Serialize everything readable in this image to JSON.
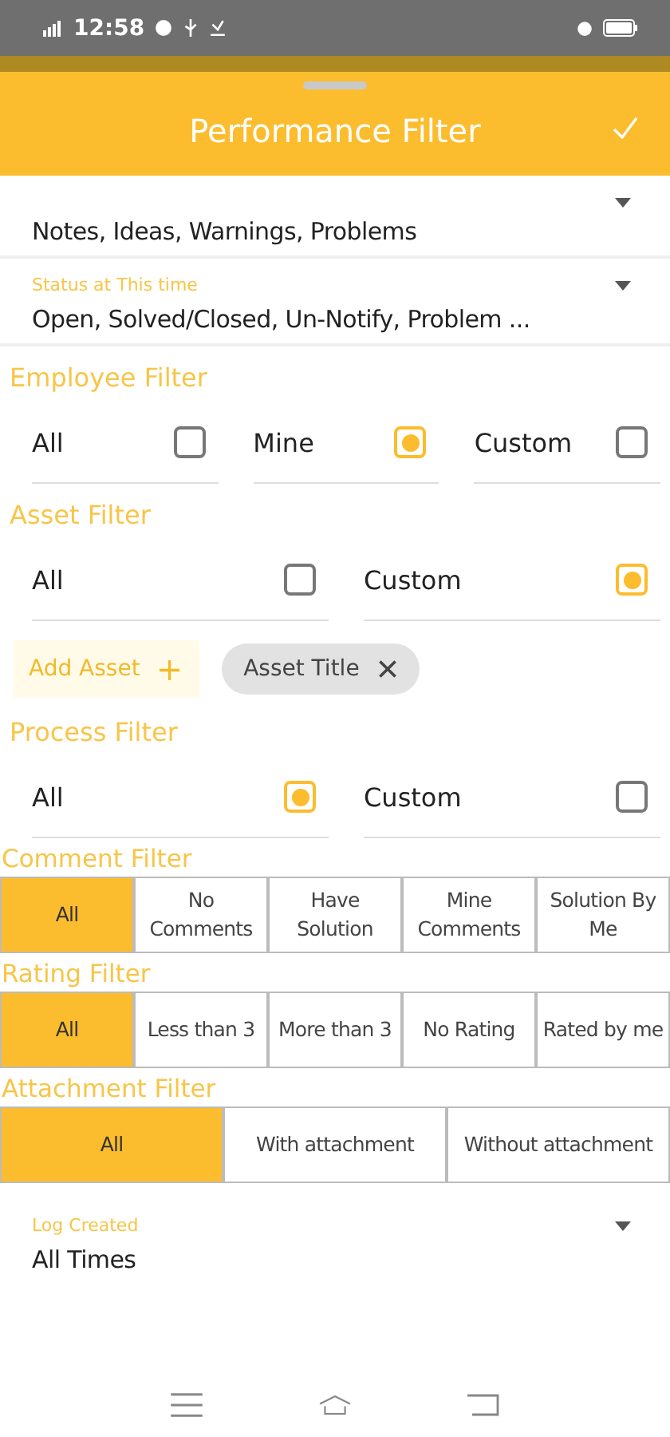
{
  "status_bar": {
    "time": "12:58"
  },
  "header": {
    "title": "Performance Filter"
  },
  "log_type": {
    "value": "Notes, Ideas, Warnings, Problems"
  },
  "status_field": {
    "label": "Status at This time",
    "value": "Open, Solved/Closed, Un-Notify, Problem ..."
  },
  "employee_filter": {
    "title": "Employee Filter",
    "options": [
      {
        "label": "All",
        "selected": false
      },
      {
        "label": "Mine",
        "selected": true
      },
      {
        "label": "Custom",
        "selected": false
      }
    ]
  },
  "asset_filter": {
    "title": "Asset Filter",
    "options": [
      {
        "label": "All",
        "selected": false
      },
      {
        "label": "Custom",
        "selected": true
      }
    ],
    "add_label": "Add Asset",
    "add_icon": "+",
    "chips": [
      {
        "label": "Asset Title"
      }
    ]
  },
  "process_filter": {
    "title": "Process Filter",
    "options": [
      {
        "label": "All",
        "selected": true
      },
      {
        "label": "Custom",
        "selected": false
      }
    ]
  },
  "comment_filter": {
    "title": "Comment Filter",
    "segments": [
      {
        "label": "All",
        "selected": true
      },
      {
        "label": "No Comments",
        "selected": false
      },
      {
        "label": "Have Solution",
        "selected": false
      },
      {
        "label": "Mine Comments",
        "selected": false
      },
      {
        "label": "Solution By Me",
        "selected": false
      }
    ]
  },
  "rating_filter": {
    "title": "Rating Filter",
    "segments": [
      {
        "label": "All",
        "selected": true
      },
      {
        "label": "Less than 3",
        "selected": false
      },
      {
        "label": "More than 3",
        "selected": false
      },
      {
        "label": "No Rating",
        "selected": false
      },
      {
        "label": "Rated by me",
        "selected": false
      }
    ]
  },
  "attachment_filter": {
    "title": "Attachment Filter",
    "segments": [
      {
        "label": "All",
        "selected": true
      },
      {
        "label": "With attachment",
        "selected": false
      },
      {
        "label": "Without attachment",
        "selected": false
      }
    ]
  },
  "log_created": {
    "label": "Log Created",
    "value": "All Times"
  }
}
